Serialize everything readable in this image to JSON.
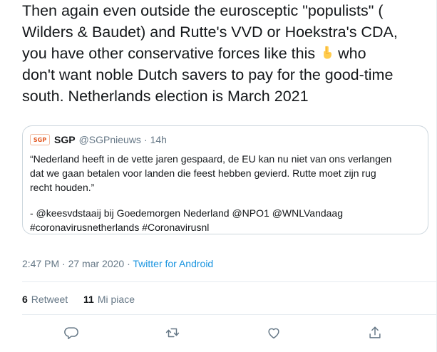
{
  "tweet": {
    "text_lines": [
      "Then again even outside the eurosceptic \"populists\" (",
      "Wilders & Baudet) and Rutte's  VVD or Hoekstra's CDA,",
      "you have other conservative forces like this",
      "who",
      "don't want noble Dutch savers to pay for the good-time",
      "south. Netherlands election is March 2021"
    ],
    "emoji": "pointing-down-emoji"
  },
  "quote": {
    "logo_text": "SGP",
    "name": "SGP",
    "handle": "@SGPnieuws",
    "separator": "·",
    "time": "14h",
    "body_lines": [
      "“Nederland heeft in de vette jaren gespaard, de EU kan nu niet van ons verlangen",
      "dat we gaan betalen voor landen die feest hebben gevierd. Rutte moet zijn rug",
      "recht houden.”",
      "- @keesvdstaaij bij Goedemorgen Nederland @NPO1 @WNLVandaag",
      "#coronavirusnetherlands #Coronavirusnl"
    ]
  },
  "meta": {
    "timestamp": "2:47 PM · 27 mar 2020",
    "separator": " · ",
    "source": "Twitter for Android"
  },
  "stats": {
    "retweets_count": "6",
    "retweets_label": "Retweet",
    "likes_count": "11",
    "likes_label": "Mi piace"
  },
  "colors": {
    "text": "#14171a",
    "secondary": "#657786",
    "link": "#1b95e0",
    "border": "#ccd6dd",
    "divider": "#e6ecf0",
    "sgp_orange": "#e2541b"
  },
  "actions": [
    "reply-icon",
    "retweet-icon",
    "like-icon",
    "share-icon"
  ]
}
